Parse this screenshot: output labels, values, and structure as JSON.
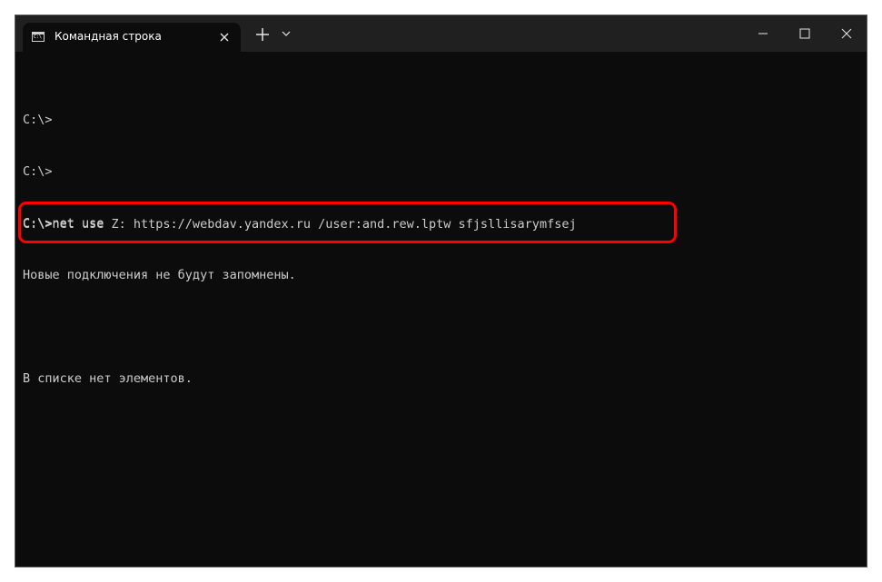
{
  "window": {
    "tab_title": "Командная строка",
    "tab_icon": "cmd-icon",
    "close_tab_icon": "close-icon",
    "new_tab_icon": "plus-icon",
    "dropdown_icon": "chevron-down-icon",
    "minimize_icon": "minimize-icon",
    "maximize_icon": "maximize-icon",
    "close_window_icon": "close-icon"
  },
  "terminal": {
    "lines": [
      "C:\\>",
      "C:\\>",
      "C:\\>net use",
      "Новые подключения не будут запомнены.",
      "",
      "В списке нет элементов.",
      ""
    ],
    "highlighted_command": "C:\\>net use Z: https://webdav.yandex.ru /user:and.rew.lptw sfjsllisarymfsej"
  },
  "colors": {
    "highlight": "#ff0000",
    "terminal_bg": "#0c0c0c",
    "titlebar_bg": "#202020",
    "text": "#cccccc"
  }
}
